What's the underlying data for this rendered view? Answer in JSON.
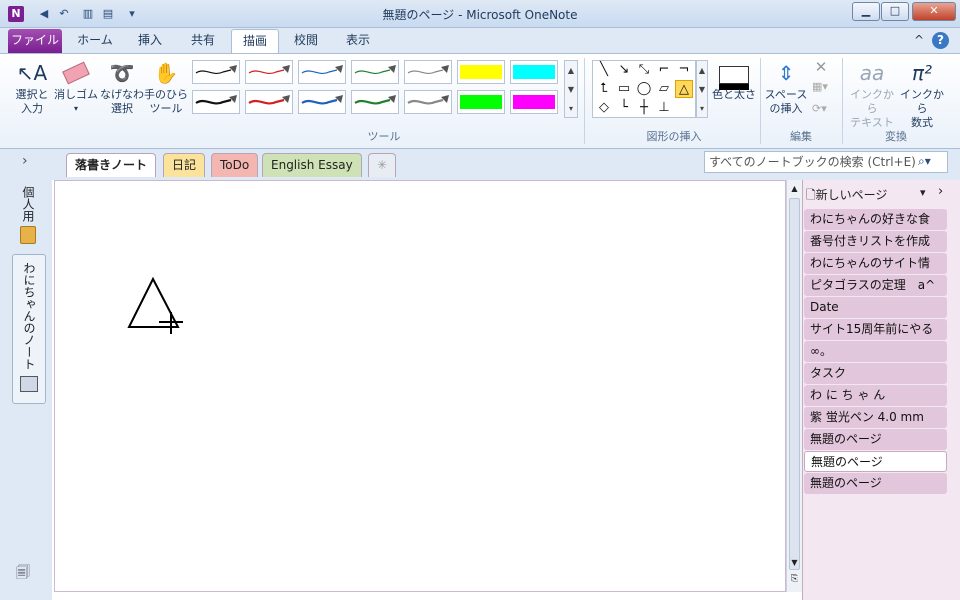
{
  "app": {
    "logo_letter": "N",
    "title": "無題のページ  -  Microsoft OneNote"
  },
  "quick_access": {
    "back_icon": "back-icon",
    "undo_icon": "undo-icon",
    "dock_icon": "dock-icon",
    "fullpage_icon": "fullpage-icon",
    "customize": "▾"
  },
  "window_buttons": {
    "minimize": "▁",
    "maximize": "□",
    "close": "✕",
    "help": "?",
    "collapse": "^"
  },
  "ribbon_tabs": [
    "ファイル",
    "ホーム",
    "挿入",
    "共有",
    "描画",
    "校閲",
    "表示"
  ],
  "ribbon": {
    "select_label": "選択と\n入力",
    "eraser_label": "消しゴム",
    "lasso_label": "なげなわ\n選択",
    "hand_label": "手のひら\nツール",
    "tools_group": "ツール",
    "shapes_group": "図形の挿入",
    "color_width_label": "色と太さ",
    "insert_space_label": "スペース\nの挿入",
    "edit_group": "編集",
    "ink_to_text_label": "インクから\nテキスト",
    "ink_to_math_label": "インクから\n数式",
    "convert_group": "変換"
  },
  "pens": [
    {
      "color": "#111111",
      "type": "pen"
    },
    {
      "color": "#d02020",
      "type": "pen"
    },
    {
      "color": "#2060c0",
      "type": "pen"
    },
    {
      "color": "#208030",
      "type": "pen"
    },
    {
      "color": "#888888",
      "type": "pen"
    },
    {
      "color": "#ffff00",
      "type": "highlighter"
    },
    {
      "color": "#00ffff",
      "type": "highlighter"
    },
    {
      "color": "#111111",
      "type": "pen"
    },
    {
      "color": "#d02020",
      "type": "pen"
    },
    {
      "color": "#2060c0",
      "type": "pen"
    },
    {
      "color": "#208030",
      "type": "pen"
    },
    {
      "color": "#888888",
      "type": "pen"
    },
    {
      "color": "#00ff00",
      "type": "highlighter"
    },
    {
      "color": "#ff00ff",
      "type": "highlighter"
    }
  ],
  "notebook_tabs": [
    {
      "label": "落書きノート",
      "color": "#ffffff"
    },
    {
      "label": "日記",
      "color": "#fbe39b"
    },
    {
      "label": "ToDo",
      "color": "#f4b6b1"
    },
    {
      "label": "English Essay",
      "color": "#cfe2b6"
    },
    {
      "label": "✳",
      "color": "#e8edf3"
    }
  ],
  "search": {
    "placeholder": "すべてのノートブックの検索 (Ctrl+E)"
  },
  "sidebar": {
    "expand": "›",
    "notebook1": "個人用",
    "notebook2": "わにちゃんのノート"
  },
  "pages_panel": {
    "new_page": "新しいページ",
    "pages": [
      "わにちゃんの好きな食",
      "番号付きリストを作成",
      "わにちゃんのサイト情",
      "ピタゴラスの定理　a^",
      "Date",
      "サイト15周年前にやる",
      "∞。",
      "タスク",
      "わ に ち ゃ ん",
      "紫 蛍光ペン 4.0 mm",
      "無題のページ",
      "無題のページ",
      "無題のページ"
    ],
    "selected_index": 11
  }
}
